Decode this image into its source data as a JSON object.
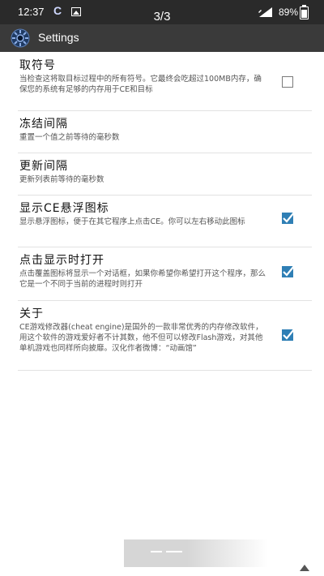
{
  "status_bar": {
    "time": "12:37",
    "ce_mark": "C",
    "page_indicator": "3/3",
    "battery": "89%"
  },
  "action_bar": {
    "title": "Settings"
  },
  "preferences": [
    {
      "title": "取符号",
      "summary": "当检查这将取目标过程中的所有符号。它最终会吃超过100MB内存，确保您的系统有足够的内存用于CE和目标",
      "checked": false
    },
    {
      "title": "冻结间隔",
      "summary": "重置一个值之前等待的毫秒数"
    },
    {
      "title": "更新间隔",
      "summary": "更新列表前等待的毫秒数"
    },
    {
      "title": "显示CE悬浮图标",
      "summary": "显示悬浮图标，便于在其它程序上点击CE。你可以左右移动此图标",
      "checked": true
    },
    {
      "title": "点击显示时打开",
      "summary": "点击覆盖图标将显示一个对话框，如果你希望你希望打开这个程序，那么它是一个不同于当前的进程时则打开",
      "checked": true
    },
    {
      "title": "关于",
      "summary": "CE游戏修改器(cheat engine)是国外的一款非常优秀的内存修改软件，用这个软件的游戏爱好者不计其数，他不但可以修改Flash游戏，对其他单机游戏也同样所向披靡。汉化作者微博：“动画馆”",
      "checked": true
    }
  ],
  "colors": {
    "status_bar": "#2a2a2a",
    "action_bar": "#3a3a3a",
    "checkbox_checked": "#2f7fb5"
  }
}
